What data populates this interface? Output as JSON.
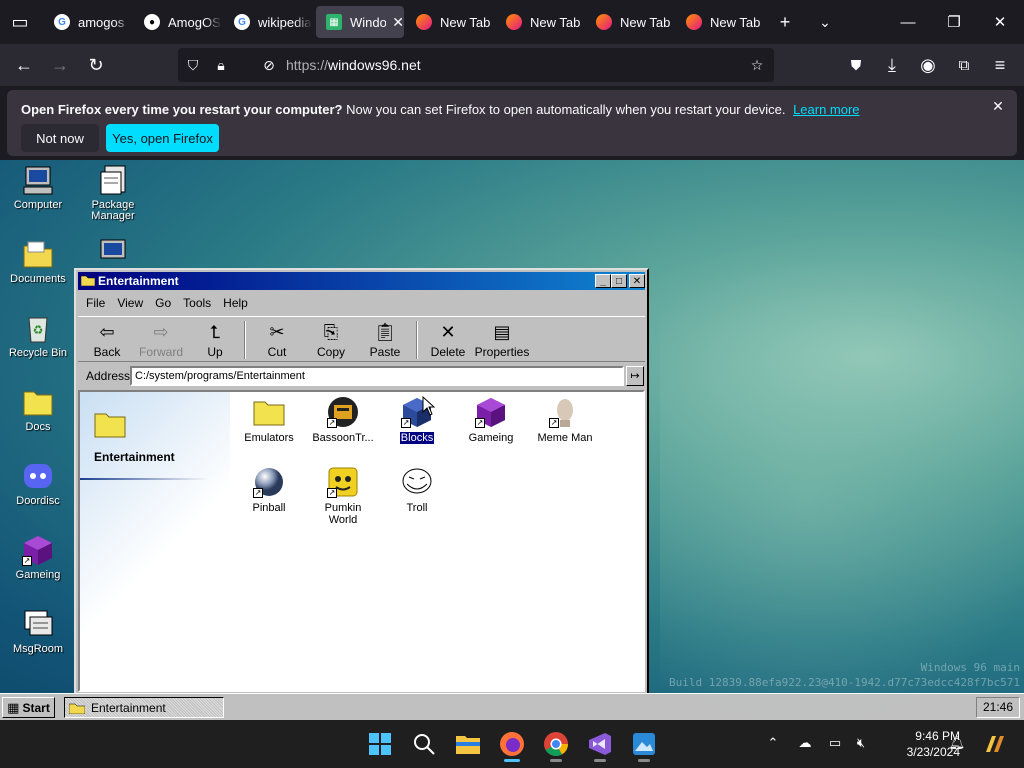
{
  "browser": {
    "tabs": [
      {
        "label": "amogos",
        "icon": "google-icon"
      },
      {
        "label": "AmogOS",
        "icon": "github-icon"
      },
      {
        "label": "wikipedia",
        "icon": "google-icon"
      },
      {
        "label": "Windo",
        "icon": "windows96-icon",
        "active": true
      },
      {
        "label": "New Tab",
        "icon": "firefox-icon"
      },
      {
        "label": "New Tab",
        "icon": "firefox-icon"
      },
      {
        "label": "New Tab",
        "icon": "firefox-icon"
      },
      {
        "label": "New Tab",
        "icon": "firefox-icon"
      }
    ],
    "url_protocol": "https://",
    "url_host": "windows96.net"
  },
  "notification": {
    "title": "Open Firefox every time you restart your computer?",
    "body": "Now you can set Firefox to open automatically when you restart your device.",
    "link": "Learn more",
    "dismiss": "Not now",
    "accept": "Yes, open Firefox"
  },
  "desktop": {
    "icons": [
      {
        "label": "Computer",
        "icon": "computer-icon"
      },
      {
        "label": "Package Manager",
        "icon": "package-icon"
      },
      {
        "label": "Documents",
        "icon": "folder-icon"
      },
      {
        "label": "Recycle Bin",
        "icon": "recycle-bin-icon"
      },
      {
        "label": "Docs",
        "icon": "folder-icon"
      },
      {
        "label": "Doordisc",
        "icon": "discord-icon"
      },
      {
        "label": "Gameing",
        "icon": "cube-icon"
      },
      {
        "label": "MsgRoom",
        "icon": "msgroom-icon"
      }
    ],
    "watermark_line1": "Windows 96 main",
    "watermark_line2": "Build 12839.88efa922.23@410-1942.d77c73edcc428f7bc571"
  },
  "explorer": {
    "title": "Entertainment",
    "menu": [
      "File",
      "View",
      "Go",
      "Tools",
      "Help"
    ],
    "toolbar": {
      "back": "Back",
      "forward": "Forward",
      "up": "Up",
      "cut": "Cut",
      "copy": "Copy",
      "paste": "Paste",
      "delete": "Delete",
      "properties": "Properties"
    },
    "address_label": "Address",
    "address": "C:/system/programs/Entertainment",
    "side_title": "Entertainment",
    "files": [
      {
        "label": "Emulators",
        "icon": "folder-icon"
      },
      {
        "label": "BassoonTr...",
        "icon": "bassoon-icon",
        "shortcut": true
      },
      {
        "label": "Blocks",
        "icon": "blocks-icon",
        "shortcut": true,
        "selected": true
      },
      {
        "label": "Gameing",
        "icon": "cube-icon",
        "shortcut": true
      },
      {
        "label": "Meme Man",
        "icon": "meme-man-icon",
        "shortcut": true
      },
      {
        "label": "Pinball",
        "icon": "pinball-icon",
        "shortcut": true
      },
      {
        "label": "Pumkin World",
        "icon": "pumpkin-icon",
        "shortcut": true
      },
      {
        "label": "Troll",
        "icon": "troll-icon",
        "shortcut": false
      }
    ]
  },
  "w96taskbar": {
    "start": "Start",
    "task": "Entertainment",
    "clock": "21:46"
  },
  "os": {
    "time": "9:46 PM",
    "date": "3/23/2024"
  }
}
